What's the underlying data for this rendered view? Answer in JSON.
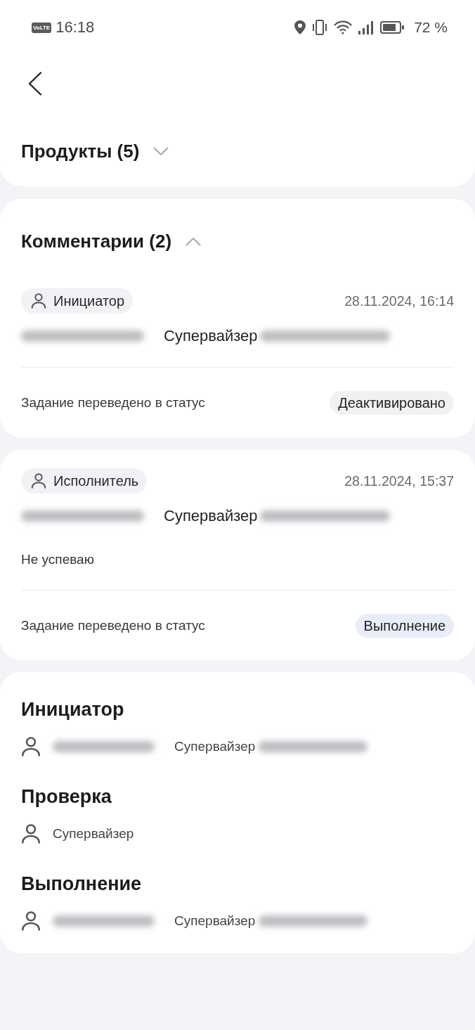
{
  "status_bar": {
    "network_badge": "VoLTE",
    "time": "16:18",
    "battery": "72 %"
  },
  "products": {
    "title": "Продукты (5)",
    "expanded": false
  },
  "comments": {
    "title": "Комментарии (2)",
    "expanded": true,
    "items": [
      {
        "role": "Инициатор",
        "date": "28.11.2024, 16:14",
        "author": {
          "role": "Супервайзер",
          "redacted": true
        },
        "status_text": "Задание переведено в статус",
        "status": {
          "label": "Деактивировано",
          "color": "#f1f1f4"
        }
      },
      {
        "role": "Исполнитель",
        "date": "28.11.2024, 15:37",
        "author": {
          "role": "Супервайзер",
          "redacted": true
        },
        "note": "Не успеваю",
        "status_text": "Задание переведено в статус",
        "status": {
          "label": "Выполнение",
          "color": "#e7eef9"
        }
      }
    ]
  },
  "participants": [
    {
      "title": "Инициатор",
      "role": "Супервайзер",
      "redacted": true
    },
    {
      "title": "Проверка",
      "role": "Супервайзер",
      "redacted": false
    },
    {
      "title": "Выполнение",
      "role": "Супервайзер",
      "redacted": true
    }
  ]
}
